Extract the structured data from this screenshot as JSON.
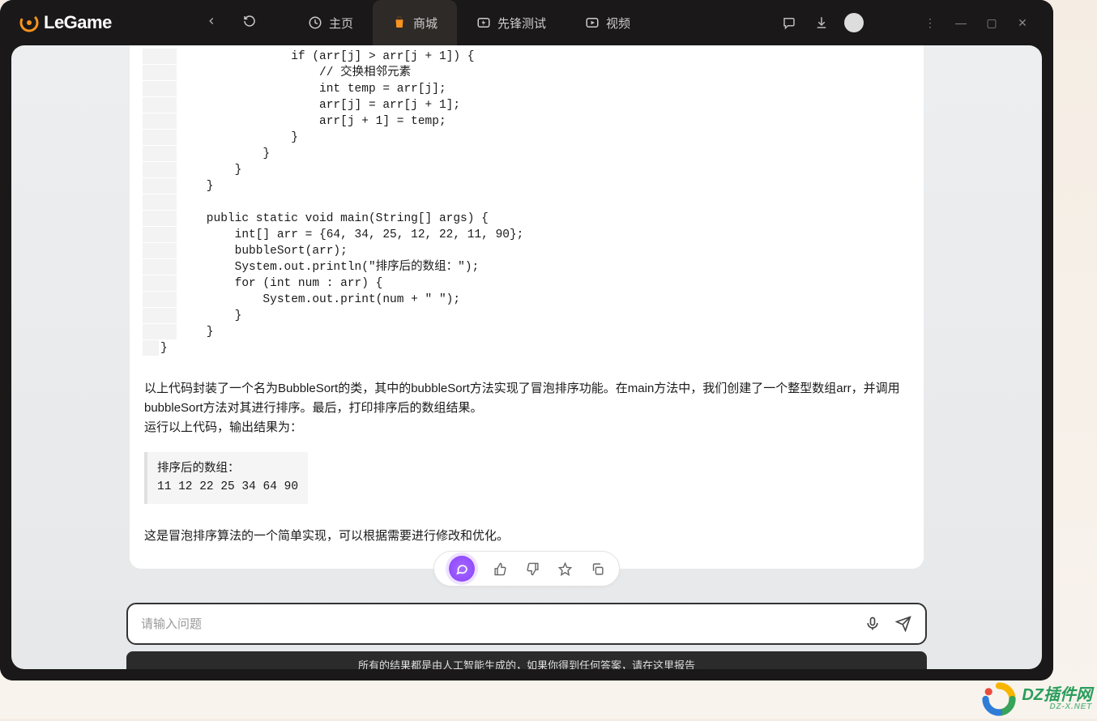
{
  "app": {
    "name": "LeGame"
  },
  "nav": {
    "tabs": [
      {
        "label": "主页"
      },
      {
        "label": "商城"
      },
      {
        "label": "先锋测试"
      },
      {
        "label": "视频"
      }
    ]
  },
  "code": {
    "lines": [
      "            if (arr[j] > arr[j + 1]) {",
      "                // 交换相邻元素",
      "                int temp = arr[j];",
      "                arr[j] = arr[j + 1];",
      "                arr[j + 1] = temp;",
      "            }",
      "        }",
      "    }",
      "}",
      "",
      "public static void main(String[] args) {",
      "    int[] arr = {64, 34, 25, 12, 22, 11, 90};",
      "    bubbleSort(arr);",
      "    System.out.println(\"排序后的数组：\");",
      "    for (int num : arr) {",
      "        System.out.print(num + \" \");",
      "    }",
      "}"
    ],
    "tail": "}"
  },
  "explain": {
    "p1": "以上代码封装了一个名为BubbleSort的类，其中的bubbleSort方法实现了冒泡排序功能。在main方法中，我们创建了一个整型数组arr，并调用bubbleSort方法对其进行排序。最后，打印排序后的数组结果。",
    "p2": "运行以上代码，输出结果为：",
    "p3": "这是冒泡排序算法的一个简单实现，可以根据需要进行修改和优化。"
  },
  "output": {
    "line1": "排序后的数组：",
    "line2": "11 12 22 25 34 64 90"
  },
  "input": {
    "placeholder": "请输入问题"
  },
  "footer": {
    "text": "所有的结果都是由人工智能生成的，如果你得到任何答案，请在这里报告"
  },
  "watermark": {
    "main": "DZ插件网",
    "sub": "DZ-X.NET"
  }
}
